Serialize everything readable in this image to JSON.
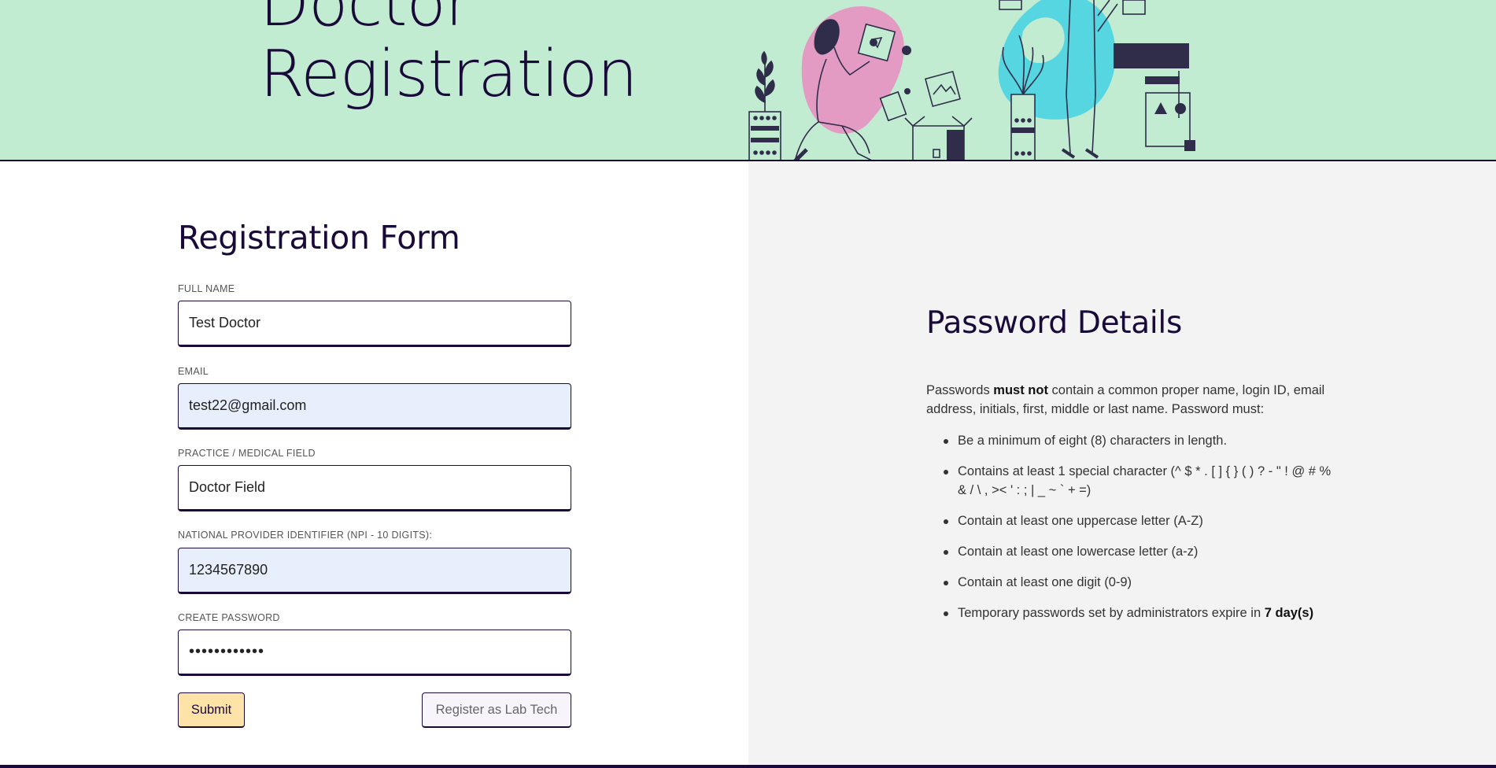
{
  "hero": {
    "title_line1": "Doctor",
    "title_line2": "Registration"
  },
  "form": {
    "title": "Registration Form",
    "fields": [
      {
        "label": "FULL NAME",
        "value": "Test Doctor",
        "autofilled": false
      },
      {
        "label": "EMAIL",
        "value": "test22@gmail.com",
        "autofilled": true
      },
      {
        "label": "PRACTICE / MEDICAL FIELD",
        "value": "Doctor Field",
        "autofilled": false
      },
      {
        "label": "NATIONAL PROVIDER IDENTIFIER (NPI - 10 DIGITS):",
        "value": "1234567890",
        "autofilled": true
      },
      {
        "label": "CREATE PASSWORD",
        "value": "••••••••••••",
        "autofilled": false
      }
    ],
    "submit_label": "Submit",
    "labtech_label": "Register as Lab Tech"
  },
  "password_details": {
    "title": "Password Details",
    "intro_pre": "Passwords ",
    "intro_bold": "must not",
    "intro_post": " contain a common proper name, login ID, email address, initials, first, middle or last name. Password must:",
    "rules": [
      "Be a minimum of eight (8) characters in length.",
      "Contains at least 1 special character (^ $ * . [ ] { } ( ) ? - \" ! @ # % & / \\ , >< ' : ; | _ ~ ` + =)",
      "Contain at least one uppercase letter (A-Z)",
      "Contain at least one lowercase letter (a-z)",
      "Contain at least one digit (0-9)"
    ],
    "last_rule_pre": "Temporary passwords set by administrators expire in ",
    "last_rule_bold": "7 day(s)"
  },
  "colors": {
    "hero_bg": "#c2ecd2",
    "ink": "#1a0a3a",
    "submit_bg": "#fde3a8",
    "autofill_bg": "#e8effc",
    "panel_bg": "#f3f3f3",
    "art_pink": "#e39bc3",
    "art_cyan": "#55d6e0"
  }
}
